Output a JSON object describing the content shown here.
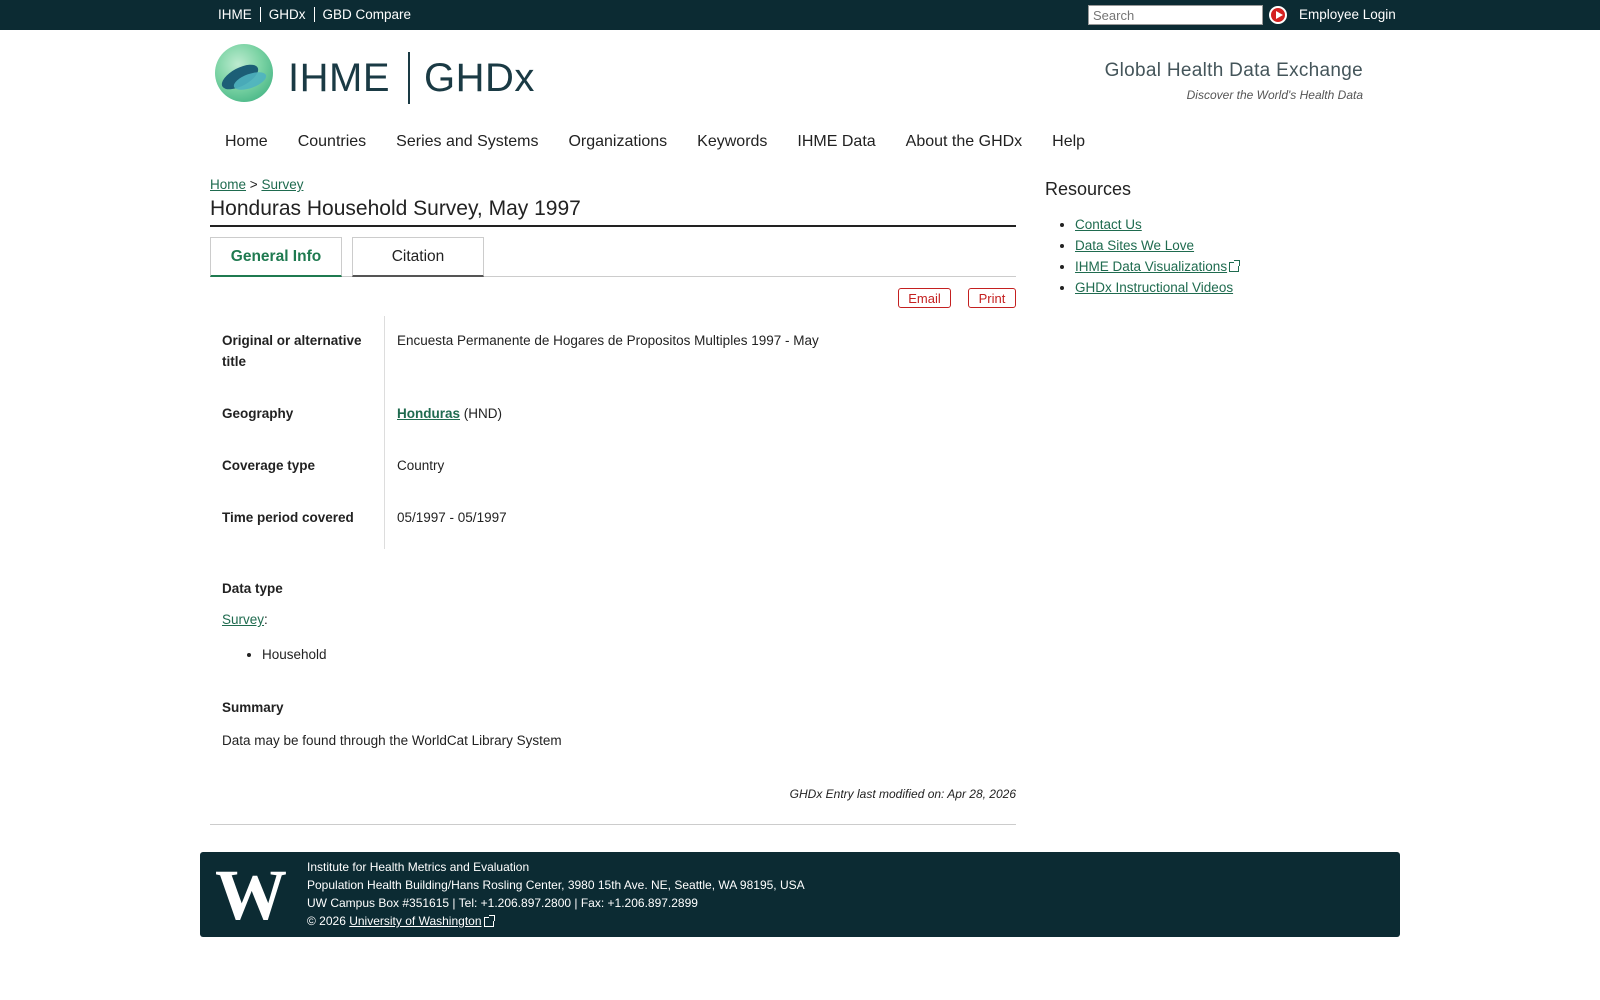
{
  "topbar": {
    "links": [
      "IHME",
      "GHDx",
      "GBD Compare"
    ],
    "search_placeholder": "Search",
    "login": "Employee Login"
  },
  "header": {
    "logo_left": "IHME",
    "logo_right": "GHDx",
    "tagline": "Global Health Data Exchange",
    "subtagline": "Discover the World's Health Data"
  },
  "nav": [
    "Home",
    "Countries",
    "Series and Systems",
    "Organizations",
    "Keywords",
    "IHME Data",
    "About the GHDx",
    "Help"
  ],
  "breadcrumb": {
    "home": "Home",
    "sep": ">",
    "current": "Survey"
  },
  "page_title": "Honduras Household Survey, May 1997",
  "tabs": {
    "general": "General Info",
    "citation": "Citation"
  },
  "actions": {
    "email": "Email",
    "print": "Print"
  },
  "info": {
    "original_title_label": "Original or alternative title",
    "original_title_value": "Encuesta Permanente de Hogares de Propositos Multiples 1997 - May",
    "geography_label": "Geography",
    "geography_link": "Honduras",
    "geography_code": "(HND)",
    "coverage_label": "Coverage type",
    "coverage_value": "Country",
    "time_label": "Time period covered",
    "time_value": "05/1997 - 05/1997"
  },
  "data_type": {
    "heading": "Data type",
    "link": "Survey",
    "items": [
      "Household"
    ]
  },
  "summary": {
    "heading": "Summary",
    "text": "Data may be found through the WorldCat Library System"
  },
  "modified": "GHDx Entry last modified on: Apr 28, 2026",
  "resources": {
    "title": "Resources",
    "items": [
      "Contact Us",
      "Data Sites We Love",
      "IHME Data Visualizations",
      "GHDx Instructional Videos"
    ]
  },
  "footer": {
    "logo": "W",
    "line1": "Institute for Health Metrics and Evaluation",
    "line2": "Population Health Building/Hans Rosling Center, 3980 15th Ave. NE, Seattle, WA 98195, USA",
    "line3": "UW Campus Box #351615 | Tel: +1.206.897.2800 | Fax: +1.206.897.2899",
    "copyright": "© 2026",
    "uw_link": "University of Washington"
  }
}
